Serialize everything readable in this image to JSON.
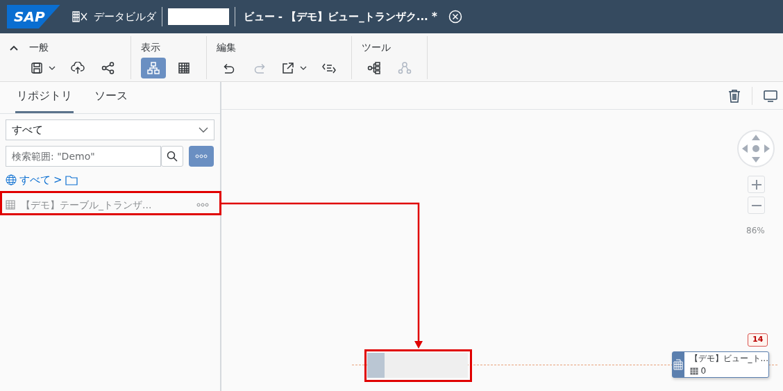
{
  "shell": {
    "logo": "SAP",
    "app": "データビルダ",
    "title": "ビュー - 【デモ】ビュー_トランザク... *"
  },
  "toolbar": {
    "groups": [
      {
        "label": "一般",
        "tools": [
          {
            "kind": "save",
            "dropdown": true,
            "selected": false,
            "disabled": false
          },
          {
            "kind": "deploy",
            "dropdown": false,
            "selected": false,
            "disabled": false
          },
          {
            "kind": "share",
            "dropdown": false,
            "selected": false,
            "disabled": false
          }
        ]
      },
      {
        "label": "表示",
        "tools": [
          {
            "kind": "diagram",
            "dropdown": false,
            "selected": true,
            "disabled": false
          },
          {
            "kind": "table",
            "dropdown": false,
            "selected": false,
            "disabled": false
          }
        ]
      },
      {
        "label": "編集",
        "tools": [
          {
            "kind": "undo",
            "dropdown": false,
            "selected": false,
            "disabled": false
          },
          {
            "kind": "redo",
            "dropdown": false,
            "selected": false,
            "disabled": true
          },
          {
            "kind": "export",
            "dropdown": true,
            "selected": false,
            "disabled": false
          },
          {
            "kind": "sort",
            "dropdown": false,
            "selected": false,
            "disabled": false
          }
        ]
      },
      {
        "label": "ツール",
        "tools": [
          {
            "kind": "impact",
            "dropdown": false,
            "selected": false,
            "disabled": false
          },
          {
            "kind": "lineage",
            "dropdown": false,
            "selected": false,
            "disabled": true
          }
        ]
      }
    ]
  },
  "sidebar": {
    "tabs": [
      {
        "label": "リポジトリ",
        "selected": true
      },
      {
        "label": "ソース",
        "selected": false
      }
    ],
    "filter": {
      "value": "すべて"
    },
    "search": {
      "placeholder": "検索範囲: \"Demo\""
    },
    "breadcrumb": {
      "root": "すべて",
      "separator": ">"
    },
    "items": [
      {
        "label": "【デモ】テーブル_トランザ..."
      }
    ]
  },
  "canvas": {
    "zoom": "86%",
    "node": {
      "title": "【デモ】ビュー_ト...",
      "count": "0",
      "badge": "14"
    }
  }
}
